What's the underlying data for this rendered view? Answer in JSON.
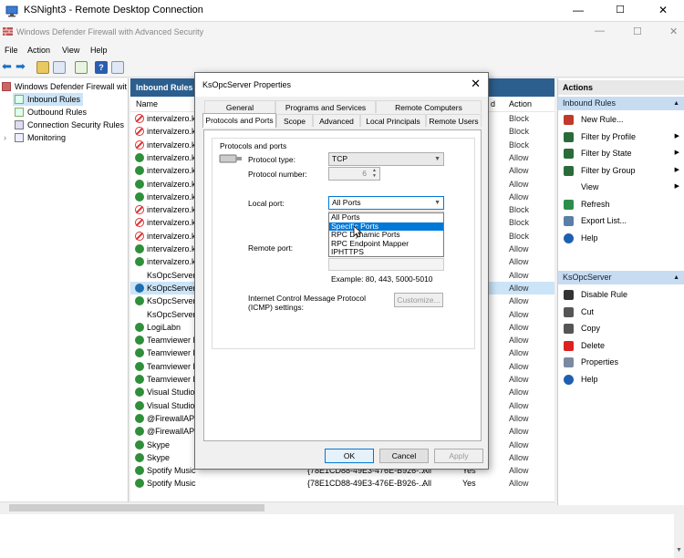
{
  "rdp": {
    "title": "KSNight3 - Remote Desktop Connection",
    "min": "—",
    "max": "☐",
    "close": "✕"
  },
  "app": {
    "title": "Windows Defender Firewall with Advanced Security",
    "min": "—",
    "max": "☐",
    "close": "✕"
  },
  "menu": [
    "File",
    "Action",
    "View",
    "Help"
  ],
  "tree": {
    "root": "Windows Defender Firewall wit",
    "items": [
      "Inbound Rules",
      "Outbound Rules",
      "Connection Security Rules",
      "Monitoring"
    ]
  },
  "center": {
    "header": "Inbound Rules",
    "col_name": "Name",
    "col_action": "Action",
    "col_action_partial": "d",
    "rows": [
      {
        "name": "intervalzero.k",
        "status": "block",
        "action": "Block"
      },
      {
        "name": "intervalzero.k",
        "status": "block",
        "action": "Block"
      },
      {
        "name": "intervalzero.k",
        "status": "block",
        "action": "Block"
      },
      {
        "name": "intervalzero.k",
        "status": "ok",
        "action": "Allow"
      },
      {
        "name": "intervalzero.k",
        "status": "ok",
        "action": "Allow"
      },
      {
        "name": "intervalzero.k",
        "status": "ok",
        "action": "Allow"
      },
      {
        "name": "intervalzero.k",
        "status": "ok",
        "action": "Allow"
      },
      {
        "name": "intervalzero.k",
        "status": "block",
        "action": "Block"
      },
      {
        "name": "intervalzero.k",
        "status": "block",
        "action": "Block"
      },
      {
        "name": "intervalzero.k",
        "status": "block",
        "action": "Block"
      },
      {
        "name": "intervalzero.k",
        "status": "ok",
        "action": "Allow"
      },
      {
        "name": "intervalzero.k",
        "status": "ok",
        "action": "Allow"
      },
      {
        "name": "KsOpcServer",
        "status": "none",
        "action": "Allow"
      },
      {
        "name": "KsOpcServer",
        "status": "selok",
        "action": "Allow",
        "selected": true
      },
      {
        "name": "KsOpcServer",
        "status": "ok",
        "action": "Allow"
      },
      {
        "name": "KsOpcServer",
        "status": "none",
        "action": "Allow"
      },
      {
        "name": "LogiLabn",
        "status": "ok",
        "action": "Allow"
      },
      {
        "name": "Teamviewer R",
        "status": "ok",
        "action": "Allow"
      },
      {
        "name": "Teamviewer R",
        "status": "ok",
        "action": "Allow"
      },
      {
        "name": "Teamviewer R",
        "status": "ok",
        "action": "Allow"
      },
      {
        "name": "Teamviewer R",
        "status": "ok",
        "action": "Allow"
      },
      {
        "name": "Visual Studio",
        "status": "ok",
        "action": "Allow"
      },
      {
        "name": "Visual Studio",
        "status": "ok",
        "action": "Allow"
      },
      {
        "name": "@FirewallAPI",
        "status": "ok",
        "action": "Allow"
      },
      {
        "name": "@FirewallAPI",
        "status": "ok",
        "action": "Allow"
      },
      {
        "name": "Skype",
        "status": "ok",
        "action": "Allow"
      },
      {
        "name": "Skype",
        "status": "ok",
        "action": "Allow"
      },
      {
        "name": "Spotify Music",
        "status": "ok",
        "action": "Allow",
        "program": "{78E1CD88-49E3-476E-B926-...",
        "profile": "All",
        "enabled": "Yes"
      },
      {
        "name": "Spotify Music",
        "status": "ok",
        "action": "Allow",
        "program": "{78E1CD88-49E3-476E-B926-...",
        "profile": "All",
        "enabled": "Yes"
      }
    ]
  },
  "actions": {
    "header": "Actions",
    "section1": "Inbound Rules",
    "items1": [
      {
        "label": "New Rule...",
        "icon": "new-rule-icon",
        "arrow": ""
      },
      {
        "label": "Filter by Profile",
        "icon": "filter-icon",
        "arrow": "▶"
      },
      {
        "label": "Filter by State",
        "icon": "filter-icon",
        "arrow": "▶"
      },
      {
        "label": "Filter by Group",
        "icon": "filter-icon",
        "arrow": "▶"
      },
      {
        "label": "View",
        "icon": "",
        "arrow": "▶"
      },
      {
        "label": "Refresh",
        "icon": "refresh-icon",
        "arrow": ""
      },
      {
        "label": "Export List...",
        "icon": "export-icon",
        "arrow": ""
      },
      {
        "label": "Help",
        "icon": "help-icon",
        "arrow": ""
      }
    ],
    "section2": "KsOpcServer",
    "items2": [
      {
        "label": "Disable Rule",
        "icon": "disable-icon"
      },
      {
        "label": "Cut",
        "icon": "cut-icon"
      },
      {
        "label": "Copy",
        "icon": "copy-icon"
      },
      {
        "label": "Delete",
        "icon": "delete-icon"
      },
      {
        "label": "Properties",
        "icon": "properties-icon"
      },
      {
        "label": "Help",
        "icon": "help-icon"
      }
    ]
  },
  "dialog": {
    "title": "KsOpcServer Properties",
    "close": "✕",
    "tabs_row1": [
      "General",
      "Programs and Services",
      "Remote Computers"
    ],
    "tabs_row2": [
      "Protocols and Ports",
      "Scope",
      "Advanced",
      "Local Principals",
      "Remote Users"
    ],
    "group_label": "Protocols and ports",
    "protocol_type_label": "Protocol type:",
    "protocol_type_value": "TCP",
    "protocol_number_label": "Protocol number:",
    "protocol_number_value": "6",
    "local_port_label": "Local port:",
    "local_port_value": "All Ports",
    "local_port_options": [
      "All Ports",
      "Specific Ports",
      "RPC Dynamic Ports",
      "RPC Endpoint Mapper",
      "IPHTTPS"
    ],
    "local_port_highlighted": 1,
    "remote_port_label": "Remote port:",
    "example": "Example: 80, 443, 5000-5010",
    "icmp_label": "Internet Control Message Protocol (ICMP) settings:",
    "customize": "Customize...",
    "ok": "OK",
    "cancel": "Cancel",
    "apply": "Apply"
  }
}
